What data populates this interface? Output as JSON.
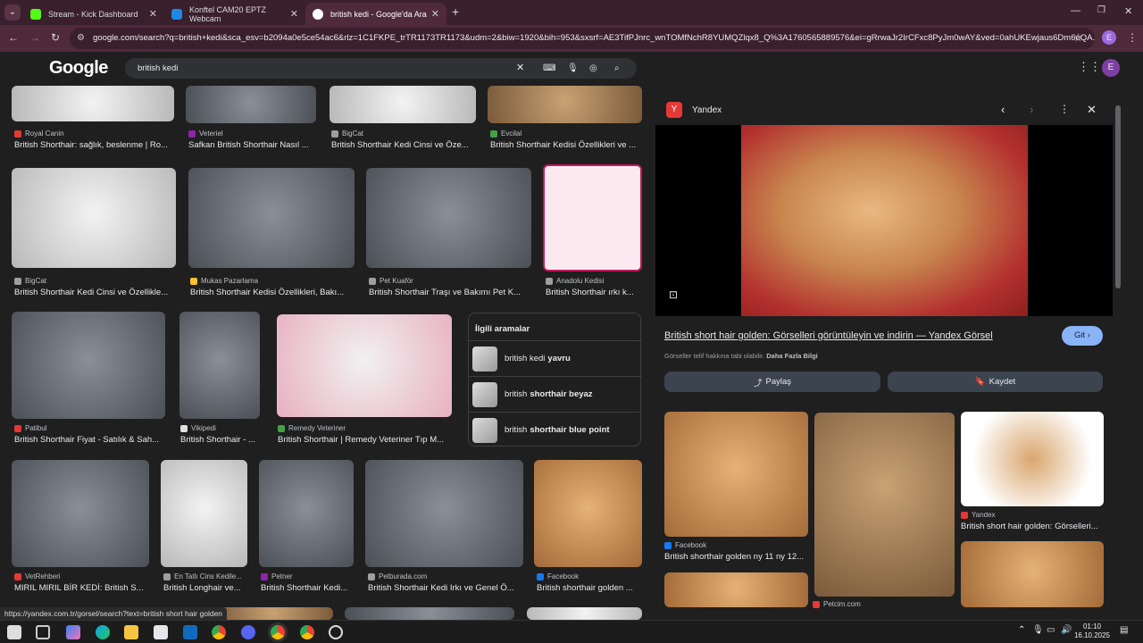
{
  "tabs": [
    {
      "label": "Stream - Kick Dashboard",
      "color": "#53fc18"
    },
    {
      "label": "Konftel CAM20 EPTZ Webcam",
      "color": "#1e88e5"
    },
    {
      "label": "british kedi - Google'da Ara",
      "color": "#4285f4"
    }
  ],
  "address": {
    "url": "google.com/search?q=british+kedi&sca_esv=b2094a0e5ce54ac6&rlz=1C1FKPE_trTR1173TR1173&udm=2&biw=1920&bih=953&sxsrf=AE3TifPJnrc_wnTOMfNchR8YUMQZlqx8_Q%3A1760565889576&ei=gRrwaJr2IrCFxc8PyJm0wAY&ved=0ahUKEwjaus6Dm6eQA..."
  },
  "google": {
    "logo": "Google",
    "query": "british kedi"
  },
  "results": [
    {
      "source": "Royal Canin",
      "title": "British Shorthair: sağlık, beslenme | Ro...",
      "color": "#e53935"
    },
    {
      "source": "Veteriel",
      "title": "Safkan British Shorthair Nasıl ...",
      "color": "#8e24aa"
    },
    {
      "source": "BigCat",
      "title": "British Shorthair Kedi Cinsi ve Öze...",
      "color": "#9e9e9e"
    },
    {
      "source": "Evcilal",
      "title": "British Shorthair Kedisi Özellikleri ve ...",
      "color": "#43a047"
    },
    {
      "source": "BigCat",
      "title": "British Shorthair Kedi Cinsi ve Özellikle...",
      "color": "#9e9e9e"
    },
    {
      "source": "Mukas Pazarlama",
      "title": "British Shorthair Kedisi Özellikleri, Bakı...",
      "color": "#fbc02d"
    },
    {
      "source": "Pet Kuaför",
      "title": "British Shorthair Traşı ve Bakımı Pet K...",
      "color": "#9e9e9e"
    },
    {
      "source": "Anadolu Kedisi",
      "title": "British Shorthair ırkı k...",
      "color": "#9e9e9e"
    },
    {
      "source": "Patibul",
      "title": "British Shorthair Fiyat - Satılık & Sah...",
      "color": "#e53935"
    },
    {
      "source": "Vikipedi",
      "title": "British Shorthair - ...",
      "color": "#e0e0e0"
    },
    {
      "source": "Remedy Veteriner",
      "title": "British Shorthair | Remedy Veteriner Tıp M...",
      "color": "#43a047"
    },
    {
      "source": "VetRehberi",
      "title": "MIRIL MIRIL BİR KEDİ: British S...",
      "color": "#e53935"
    },
    {
      "source": "En Tatlı Cins Kedile...",
      "title": "British Longhair ve...",
      "color": "#9e9e9e"
    },
    {
      "source": "Petner",
      "title": "British Shorthair Kedi...",
      "color": "#8e24aa"
    },
    {
      "source": "Petburada.com",
      "title": "British Shorthair Kedi Irkı ve Genel Ö...",
      "color": "#9e9e9e"
    },
    {
      "source": "Facebook",
      "title": "British shorthair golden ...",
      "color": "#1877f2"
    }
  ],
  "related": {
    "heading": "İlgili aramalar",
    "items": [
      {
        "pre": "british kedi ",
        "bold": "yavru"
      },
      {
        "pre": "british ",
        "bold": "shorthair beyaz"
      },
      {
        "pre": "british ",
        "bold": "shorthair blue point"
      }
    ]
  },
  "panel": {
    "source": "Yandex",
    "title": "British short hair golden: Görselleri görüntüleyin ve indirin — Yandex Görsel",
    "visit": "Git",
    "copyright": "Görseller telif hakkına tabi olabilir.",
    "more_info": "Daha Fazla Bilgi",
    "share": "Paylaş",
    "save": "Kaydet",
    "similar": [
      {
        "source": "Facebook",
        "title": "British shorthair golden ny 11 ny 12..."
      },
      {
        "source": "Petcim.com",
        "title": ""
      },
      {
        "source": "Yandex",
        "title": "British short hair golden: Görselleri..."
      }
    ]
  },
  "status_url": "https://yandex.com.tr/gorsel/search?text=british short hair golden",
  "clock": {
    "time": "01:10",
    "date": "16.10.2025"
  }
}
